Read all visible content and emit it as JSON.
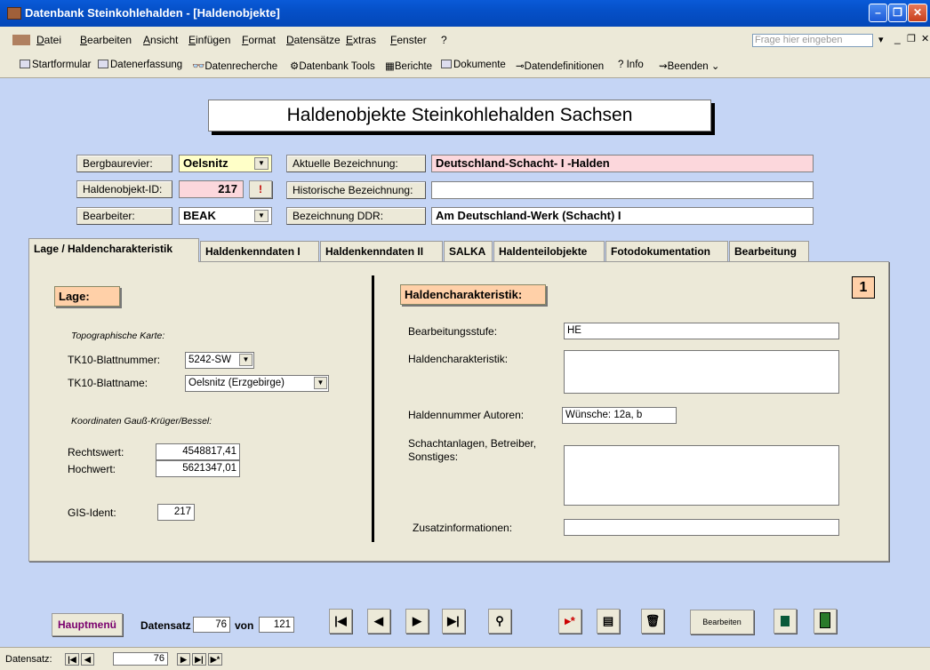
{
  "window": {
    "title": "Datenbank Steinkohlehalden - [Haldenobjekte]"
  },
  "menu": {
    "items": [
      "Datei",
      "Bearbeiten",
      "Ansicht",
      "Einfügen",
      "Format",
      "Datensätze",
      "Extras",
      "Fenster",
      "?"
    ],
    "ask_placeholder": "Frage hier eingeben"
  },
  "toolbar": {
    "items": [
      "Startformular",
      "Datenerfassung",
      "Datenrecherche",
      "Datenbank Tools",
      "Berichte",
      "Dokumente",
      "Datendefinitionen",
      "Info",
      "Beenden"
    ]
  },
  "form": {
    "title": "Haldenobjekte Steinkohlehalden Sachsen",
    "bergbaurevier": {
      "label": "Bergbaurevier:",
      "value": "Oelsnitz"
    },
    "haldenobjekt_id": {
      "label": "Haldenobjekt-ID:",
      "value": "217",
      "flag": "!"
    },
    "bearbeiter": {
      "label": "Bearbeiter:",
      "value": "BEAK"
    },
    "aktuelle": {
      "label": "Aktuelle Bezeichnung:",
      "value": "Deutschland-Schacht- I -Halden"
    },
    "historische": {
      "label": "Historische Bezeichnung:",
      "value": ""
    },
    "ddr": {
      "label": "Bezeichnung DDR:",
      "value": "Am Deutschland-Werk (Schacht) I"
    }
  },
  "tabs": [
    "Lage / Haldencharakteristik",
    "Haldenkenndaten I",
    "Haldenkenndaten II",
    "SALKA",
    "Haldenteilobjekte",
    "Fotodokumentation",
    "Bearbeitung"
  ],
  "lage": {
    "heading": "Lage:",
    "topo_caption": "Topographische Karte:",
    "tk10_nr_label": "TK10-Blattnummer:",
    "tk10_nr": "5242-SW",
    "tk10_name_label": "TK10-Blattname:",
    "tk10_name": "Oelsnitz (Erzgebirge)",
    "koord_caption": "Koordinaten Gauß-Krüger/Bessel:",
    "rechts_label": "Rechtswert:",
    "rechts": "4548817,41",
    "hoch_label": "Hochwert:",
    "hoch": "5621347,01",
    "gis_label": "GIS-Ident:",
    "gis": "217"
  },
  "charakteristik": {
    "heading": "Haldencharakteristik:",
    "page_number": "1",
    "stufe_label": "Bearbeitungsstufe:",
    "stufe": "HE",
    "char_label": "Haldencharakteristik:",
    "char": "",
    "nummer_label": "Haldennummer Autoren:",
    "nummer": "Wünsche: 12a, b",
    "schacht_label": "Schachtanlagen, Betreiber, Sonstiges:",
    "schacht": "",
    "zusatz_label": "Zusatzinformationen:",
    "zusatz": ""
  },
  "footer": {
    "hauptmenu": "Hauptmenü",
    "datensatz_label": "Datensatz",
    "datensatz": "76",
    "von_label": "von",
    "total": "121",
    "bearbeiten": "Bearbeiten"
  },
  "statusbar": {
    "label": "Datensatz:",
    "record": "76"
  }
}
